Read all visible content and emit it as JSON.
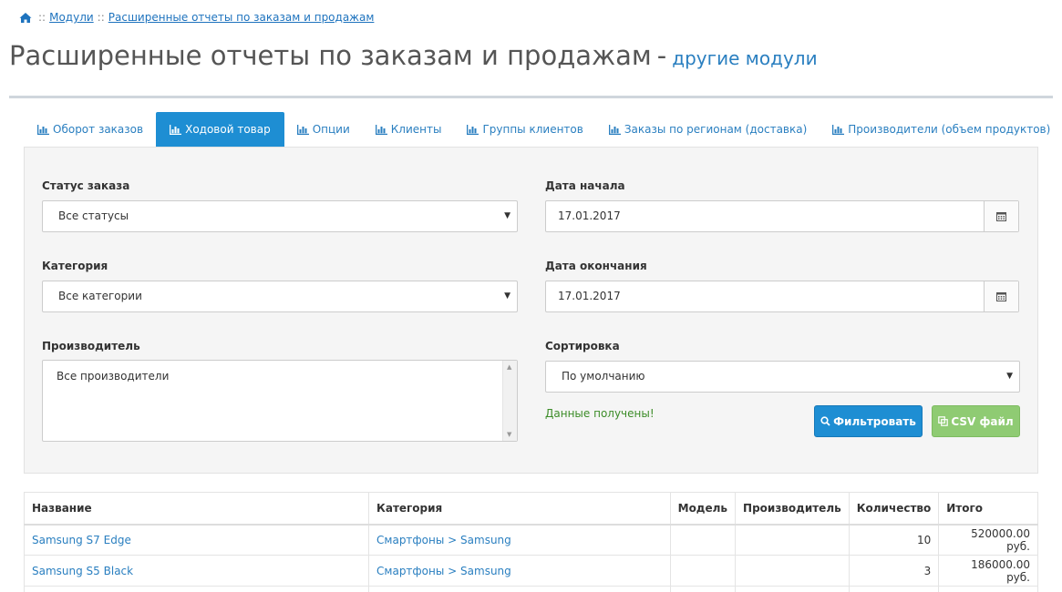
{
  "breadcrumb": {
    "sep": "::",
    "items": [
      "Модули",
      "Расширенные отчеты по заказам и продажам"
    ]
  },
  "page": {
    "title": "Расширенные отчеты по заказам и продажам",
    "dash": "-",
    "subtitle_link": "другие модули"
  },
  "tabs": [
    {
      "label": "Оборот заказов",
      "active": false
    },
    {
      "label": "Ходовой товар",
      "active": true
    },
    {
      "label": "Опции",
      "active": false
    },
    {
      "label": "Клиенты",
      "active": false
    },
    {
      "label": "Группы клиентов",
      "active": false
    },
    {
      "label": "Заказы по регионам (доставка)",
      "active": false
    },
    {
      "label": "Производители (объем продуктов)",
      "active": false
    }
  ],
  "filters": {
    "order_status": {
      "label": "Статус заказа",
      "value": "Все статусы"
    },
    "category": {
      "label": "Категория",
      "value": "Все категории"
    },
    "manufacturer": {
      "label": "Производитель",
      "value": "Все производители"
    },
    "date_start": {
      "label": "Дата начала",
      "value": "17.01.2017"
    },
    "date_end": {
      "label": "Дата окончания",
      "value": "17.01.2017"
    },
    "sort": {
      "label": "Сортировка",
      "value": "По умолчанию"
    },
    "status_message": "Данные получены!",
    "filter_button": "Фильтровать",
    "csv_button": "CSV файл"
  },
  "colors": {
    "primary": "#1e8ed3",
    "success": "#8fcb73",
    "link": "#2a7fc0",
    "status_ok": "#3c8c28"
  },
  "table": {
    "headers": [
      "Название",
      "Категория",
      "Модель",
      "Производитель",
      "Количество",
      "Итого"
    ],
    "rows": [
      {
        "name": "Samsung S7 Edge",
        "category": "Смартфоны > Samsung",
        "model": "",
        "manufacturer": "",
        "quantity": "10",
        "total": "520000.00 руб."
      },
      {
        "name": "Samsung S5 Black",
        "category": "Смартфоны > Samsung",
        "model": "",
        "manufacturer": "",
        "quantity": "3",
        "total": "186000.00 руб."
      }
    ]
  }
}
